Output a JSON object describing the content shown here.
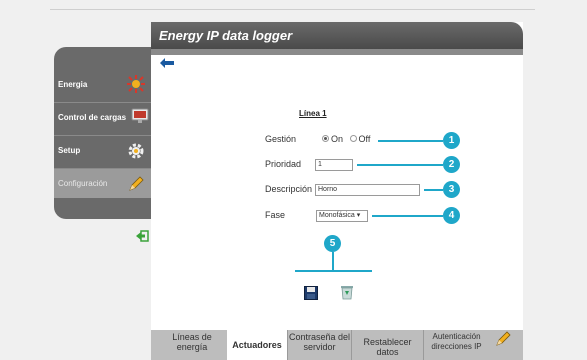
{
  "window": {
    "title": "Energy IP data logger"
  },
  "sidebar": {
    "items": [
      {
        "label": "Energia",
        "icon": "sun-icon"
      },
      {
        "label": "Control de cargas",
        "icon": "monitor-icon"
      },
      {
        "label": "Setup",
        "icon": "gear-icon"
      },
      {
        "label": "Configuración",
        "icon": "pencil-icon"
      }
    ]
  },
  "form": {
    "section_title": "Línea 1",
    "gestion_label": "Gestión",
    "gestion_on": "On",
    "gestion_off": "Off",
    "gestion_value": "On",
    "prioridad_label": "Prioridad",
    "prioridad_value": "1",
    "descripcion_label": "Descripción",
    "descripcion_value": "Horno",
    "fase_label": "Fase",
    "fase_value": "Monofásica"
  },
  "callouts": [
    "1",
    "2",
    "3",
    "4",
    "5"
  ],
  "tabs": [
    {
      "label": "Líneas de energía",
      "active": false
    },
    {
      "label": "Actuadores",
      "active": true
    },
    {
      "label": "Contraseña del servidor",
      "active": false
    },
    {
      "label": "Restablecer datos",
      "active": false
    },
    {
      "label": "Autenticación direcciones IP",
      "active": false
    }
  ],
  "colors": {
    "accent": "#1fa7c9",
    "titlebar": "#4a4a4a",
    "sidebar": "#6a6a6a",
    "back_arrow": "#1a5aa0"
  }
}
